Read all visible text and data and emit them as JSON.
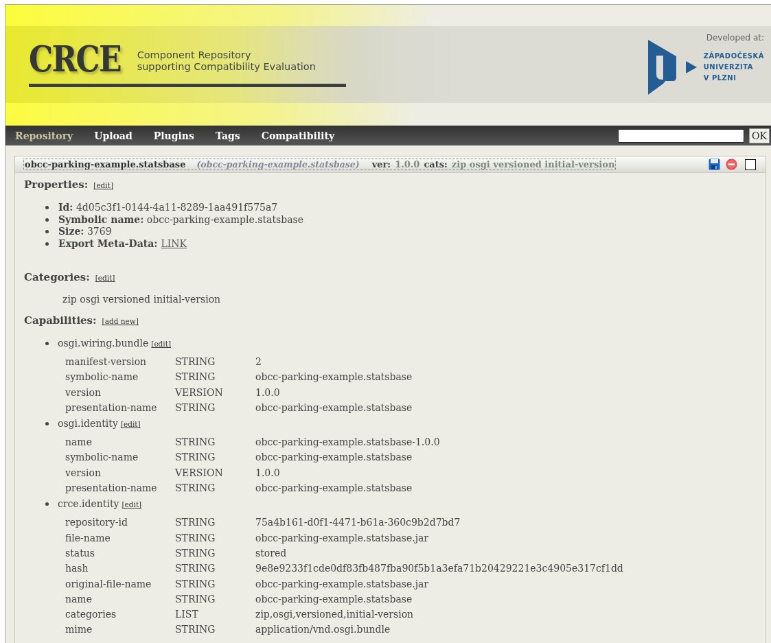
{
  "header": {
    "logo": "CRCE",
    "tagline": [
      "Component Repository",
      "supporting Compatibility Evaluation"
    ],
    "developed_at": "Developed at:",
    "university": [
      "ZÁPADOČESKÁ",
      "UNIVERZITA",
      "V PLZNI"
    ]
  },
  "nav": {
    "items": [
      {
        "label": "Repository",
        "selected": true
      },
      {
        "label": "Upload",
        "selected": false
      },
      {
        "label": "Plugins",
        "selected": false
      },
      {
        "label": "Tags",
        "selected": false
      },
      {
        "label": "Compatibility",
        "selected": false
      }
    ],
    "search_button": "OK"
  },
  "component": {
    "name": "obcc-parking-example.statsbase",
    "alias": "(obcc-parking-example.statsbase)",
    "ver_label": "ver:",
    "version": "1.0.0",
    "cats_label": "cats:",
    "cats": "zip osgi versioned initial-version",
    "checked": false
  },
  "properties": {
    "title": "Properties:",
    "edit": "[edit]",
    "items": [
      {
        "label": "Id:",
        "value": "4d05c3f1-0144-4a11-8289-1aa491f575a7",
        "kind": "text"
      },
      {
        "label": "Symbolic name:",
        "value": "obcc-parking-example.statsbase",
        "kind": "text"
      },
      {
        "label": "Size:",
        "value": "3769",
        "kind": "text"
      },
      {
        "label": "Export Meta-Data:",
        "value": "LINK",
        "kind": "link"
      }
    ]
  },
  "categories": {
    "title": "Categories:",
    "edit": "[edit]",
    "text": "zip osgi versioned initial-version"
  },
  "capabilities": {
    "title": "Capabilities:",
    "add": "[add new]",
    "groups": [
      {
        "name": "osgi.wiring.bundle",
        "edit": "[edit]",
        "attributes": [
          {
            "name": "manifest-version",
            "type": "STRING",
            "value": "2"
          },
          {
            "name": "symbolic-name",
            "type": "STRING",
            "value": "obcc-parking-example.statsbase"
          },
          {
            "name": "version",
            "type": "VERSION",
            "value": "1.0.0"
          },
          {
            "name": "presentation-name",
            "type": "STRING",
            "value": "obcc-parking-example.statsbase"
          }
        ]
      },
      {
        "name": "osgi.identity",
        "edit": "[edit]",
        "attributes": [
          {
            "name": "name",
            "type": "STRING",
            "value": "obcc-parking-example.statsbase-1.0.0"
          },
          {
            "name": "symbolic-name",
            "type": "STRING",
            "value": "obcc-parking-example.statsbase"
          },
          {
            "name": "version",
            "type": "VERSION",
            "value": "1.0.0"
          },
          {
            "name": "presentation-name",
            "type": "STRING",
            "value": "obcc-parking-example.statsbase"
          }
        ]
      },
      {
        "name": "crce.identity",
        "edit": "[edit]",
        "attributes": [
          {
            "name": "repository-id",
            "type": "STRING",
            "value": "75a4b161-d0f1-4471-b61a-360c9b2d7bd7"
          },
          {
            "name": "file-name",
            "type": "STRING",
            "value": "obcc-parking-example.statsbase.jar"
          },
          {
            "name": "status",
            "type": "STRING",
            "value": "stored"
          },
          {
            "name": "hash",
            "type": "STRING",
            "value": "9e8e9233f1cde0df83fb487fba90f5b1a3efa71b20429221e3c4905e317cf1dd"
          },
          {
            "name": "original-file-name",
            "type": "STRING",
            "value": "obcc-parking-example.statsbase.jar"
          },
          {
            "name": "name",
            "type": "STRING",
            "value": "obcc-parking-example.statsbase"
          },
          {
            "name": "categories",
            "type": "LIST",
            "value": "zip,osgi,versioned,initial-version"
          },
          {
            "name": "mime",
            "type": "STRING",
            "value": "application/vnd.osgi.bundle"
          }
        ]
      }
    ]
  }
}
